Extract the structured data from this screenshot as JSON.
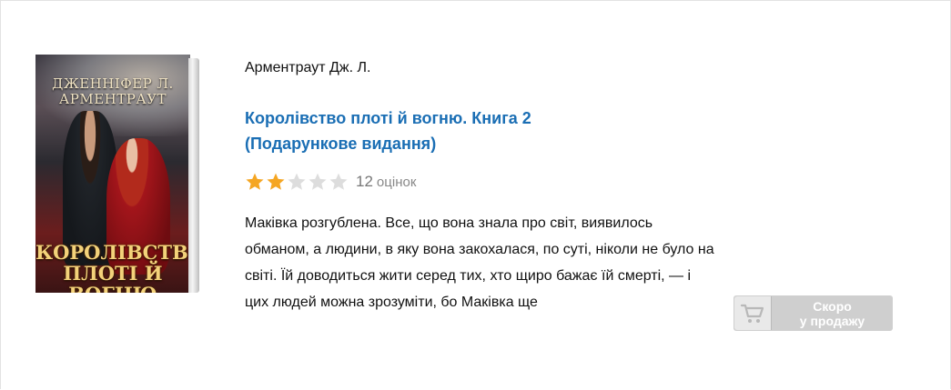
{
  "product": {
    "cover": {
      "author_text": "ДЖЕННІФЕР Л. АРМЕНТРАУТ",
      "title_text": "КОРОЛІВСТВО ПЛОТІ Й ВОГНЮ"
    },
    "author": "Арментраут Дж. Л.",
    "title_line1": "Королівство плоті й вогню. Книга 2",
    "title_line2": "(Подарункове видання)",
    "rating": {
      "stars_filled": 2,
      "stars_total": 5,
      "count": "12",
      "count_label": "оцінок",
      "star_color_filled": "#f5a623",
      "star_color_empty": "#dddddd"
    },
    "description": "Маківка розгублена. Все, що вона знала про світ, виявилось обманом, а людини, в яку вона закохалася, по суті, ніколи не було на світі. Їй доводиться жити серед тих, хто щиро бажає їй смерті, — і цих людей можна зрозуміти, бо Маківка ще",
    "soon_button": {
      "line1": "Скоро",
      "line2": "у продажу",
      "icon": "cart-icon"
    }
  }
}
